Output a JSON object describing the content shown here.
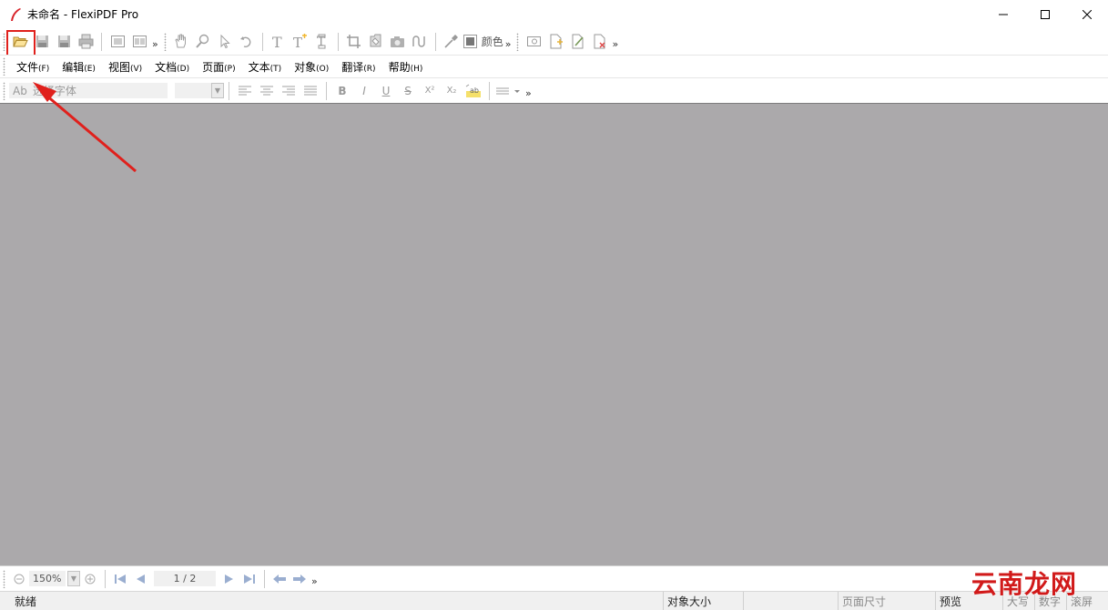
{
  "window": {
    "title": "未命名 - FlexiPDF Pro",
    "controls": [
      "minimize-icon",
      "maximize-icon",
      "close-icon"
    ]
  },
  "toolbar_main": {
    "color_label": "颜色",
    "groups": [
      [
        "open-folder-icon",
        "save-icon",
        "save-as-icon",
        "print-icon"
      ],
      [
        "page-view-icon",
        "page-layout-icon"
      ],
      [
        "hand-tool-icon",
        "zoom-tool-icon",
        "select-tool-icon",
        "lasso-tool-icon"
      ],
      [
        "text-tool-icon",
        "add-text-icon",
        "text-format-icon"
      ],
      [
        "crop-icon",
        "stamp-icon",
        "camera-icon",
        "link-icon"
      ],
      [
        "eyedropper-icon",
        "color-swatch-icon"
      ],
      [
        "image-icon",
        "new-page-icon",
        "edit-page-icon",
        "delete-page-icon"
      ]
    ]
  },
  "menu": [
    {
      "label": "文件",
      "key": "(F)"
    },
    {
      "label": "编辑",
      "key": "(E)"
    },
    {
      "label": "视图",
      "key": "(V)"
    },
    {
      "label": "文档",
      "key": "(D)"
    },
    {
      "label": "页面",
      "key": "(P)"
    },
    {
      "label": "文本",
      "key": "(T)"
    },
    {
      "label": "对象",
      "key": "(O)"
    },
    {
      "label": "翻译",
      "key": "(R)"
    },
    {
      "label": "帮助",
      "key": "(H)"
    }
  ],
  "format_bar": {
    "font_prefix": "Ab",
    "font_placeholder": "选择字体",
    "bold": "B",
    "italic": "I",
    "underline": "U",
    "strike": "S",
    "superscript": "X²",
    "subscript": "X₂"
  },
  "bottom_bar": {
    "zoom": "150%",
    "page": "1 / 2"
  },
  "status": {
    "ready": "就绪",
    "object_size": "对象大小",
    "page_size": "页面尺寸",
    "preview": "预览",
    "caps": "大写",
    "num": "数字",
    "scroll": "滚屏"
  },
  "watermark": "云南龙网",
  "colors": {
    "workspace": "#aba9ab",
    "highlight": "#e0201c",
    "logo": "#d8232a"
  }
}
